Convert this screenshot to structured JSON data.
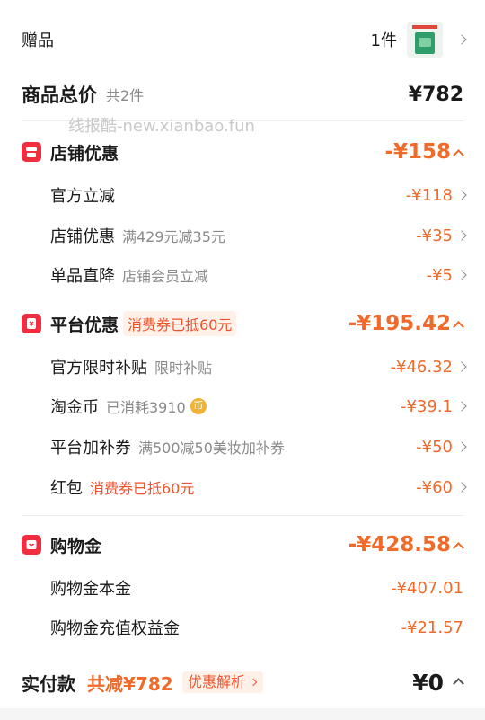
{
  "gift": {
    "label": "赠品",
    "count": "1件"
  },
  "total": {
    "label": "商品总价",
    "count": "共2件",
    "amount": "¥782"
  },
  "watermark": "线报酷-new.xianbao.fun",
  "store": {
    "title": "店铺优惠",
    "amount": "-¥158",
    "items": [
      {
        "label": "官方立减",
        "sub": "",
        "amount": "-¥118"
      },
      {
        "label": "店铺优惠",
        "sub": "满429元减35元",
        "amount": "-¥35"
      },
      {
        "label": "单品直降",
        "sub": "店铺会员立减",
        "amount": "-¥5"
      }
    ]
  },
  "platform": {
    "title": "平台优惠",
    "tag": "消费券已抵60元",
    "amount": "-¥195.42",
    "items": [
      {
        "label": "官方限时补贴",
        "sub": "限时补贴",
        "amount": "-¥46.32"
      },
      {
        "label": "淘金币",
        "sub": "已消耗3910",
        "amount": "-¥39.1"
      },
      {
        "label": "平台加补券",
        "sub": "满500减50美妆加补券",
        "amount": "-¥50"
      },
      {
        "label": "红包",
        "sub": "消费券已抵60元",
        "amount": "-¥60"
      }
    ]
  },
  "shopping_gold": {
    "title": "购物金",
    "amount": "-¥428.58",
    "items": [
      {
        "label": "购物金本金",
        "amount": "-¥407.01"
      },
      {
        "label": "购物金充值权益金",
        "amount": "-¥21.57"
      }
    ]
  },
  "footer": {
    "label": "实付款",
    "discount": "共减¥782",
    "analysis": "优惠解析",
    "amount": "¥0"
  },
  "colors": {
    "accent": "#f06a2a",
    "icon_red": "#f02e3f"
  }
}
